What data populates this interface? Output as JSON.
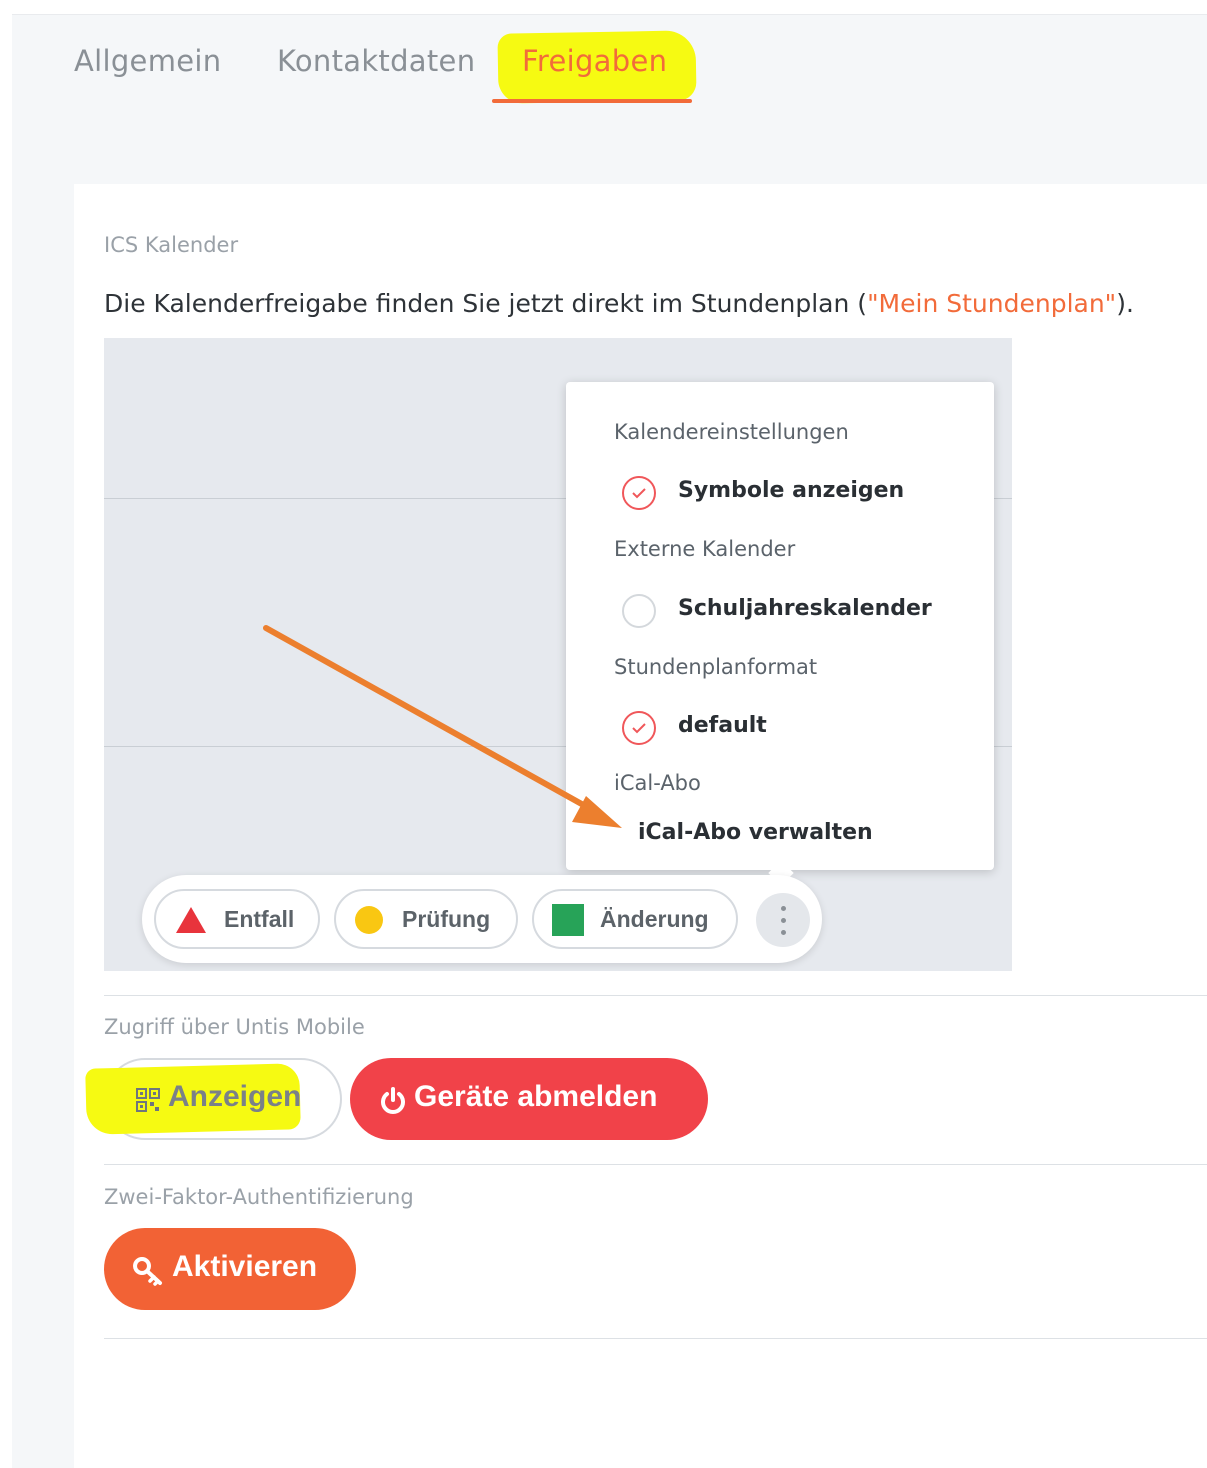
{
  "tabs": [
    {
      "label": "Allgemein",
      "active": false
    },
    {
      "label": "Kontaktdaten",
      "active": false
    },
    {
      "label": "Freigaben",
      "active": true
    }
  ],
  "ics": {
    "section_label": "ICS Kalender",
    "description_prefix": "Die Kalenderfreigabe finden Sie jetzt direkt im Stundenplan (",
    "description_link": "\"Mein Stundenplan\"",
    "description_suffix": ")."
  },
  "preview": {
    "menu": {
      "calendar_settings_heading": "Kalendereinstellungen",
      "show_symbols_label": "Symbole anzeigen",
      "show_symbols_checked": true,
      "external_calendars_heading": "Externe Kalender",
      "school_year_calendar_label": "Schuljahreskalender",
      "school_year_calendar_checked": false,
      "timetable_format_heading": "Stundenplanformat",
      "default_label": "default",
      "default_checked": true,
      "ical_heading": "iCal-Abo",
      "ical_manage_label": "iCal-Abo verwalten"
    },
    "legend": {
      "cancellation_label": "Entfall",
      "exam_label": "Prüfung",
      "change_label": "Änderung"
    }
  },
  "mobile": {
    "section_label": "Zugriff über Untis Mobile",
    "show_label": "Anzeigen",
    "logout_devices_label": "Geräte abmelden"
  },
  "two_factor": {
    "section_label": "Zwei-Faktor-Authentifizierung",
    "activate_label": "Aktivieren"
  },
  "colors": {
    "accent": "#f26b3a",
    "danger": "#f14249",
    "highlight": "#f6fa12",
    "arrow": "#ec7f2e"
  }
}
